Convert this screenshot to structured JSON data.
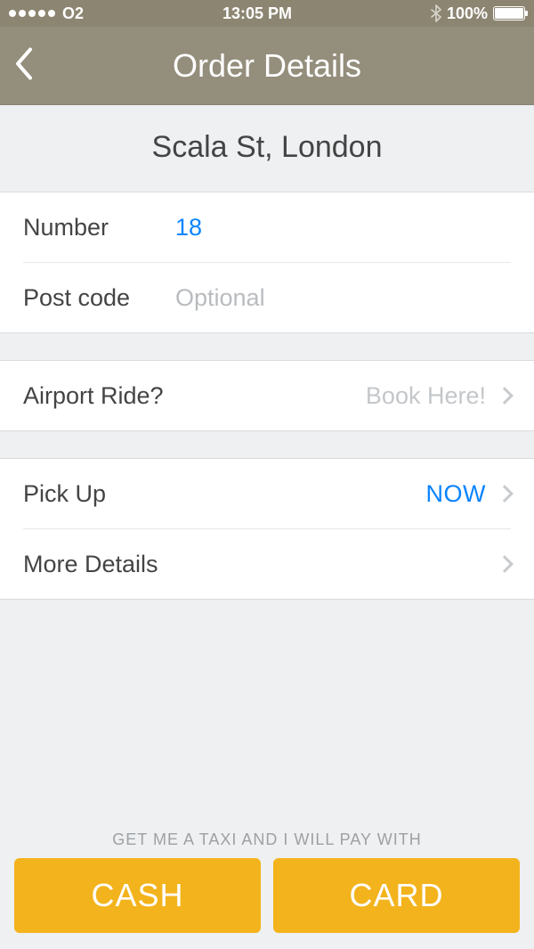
{
  "status": {
    "carrier": "O2",
    "time": "13:05 PM",
    "battery_pct": "100%"
  },
  "nav": {
    "title": "Order Details"
  },
  "address": {
    "full": "Scala St, London"
  },
  "form": {
    "number_label": "Number",
    "number_value": "18",
    "postcode_label": "Post code",
    "postcode_placeholder": "Optional"
  },
  "airport": {
    "label": "Airport Ride?",
    "cta": "Book Here!"
  },
  "options": {
    "pickup_label": "Pick Up",
    "pickup_value": "NOW",
    "more_label": "More Details"
  },
  "footer": {
    "prompt": "GET ME A TAXI AND I WILL PAY WITH",
    "cash": "CASH",
    "card": "CARD"
  },
  "colors": {
    "accent": "#0a84ff",
    "cta": "#f3b31c"
  }
}
